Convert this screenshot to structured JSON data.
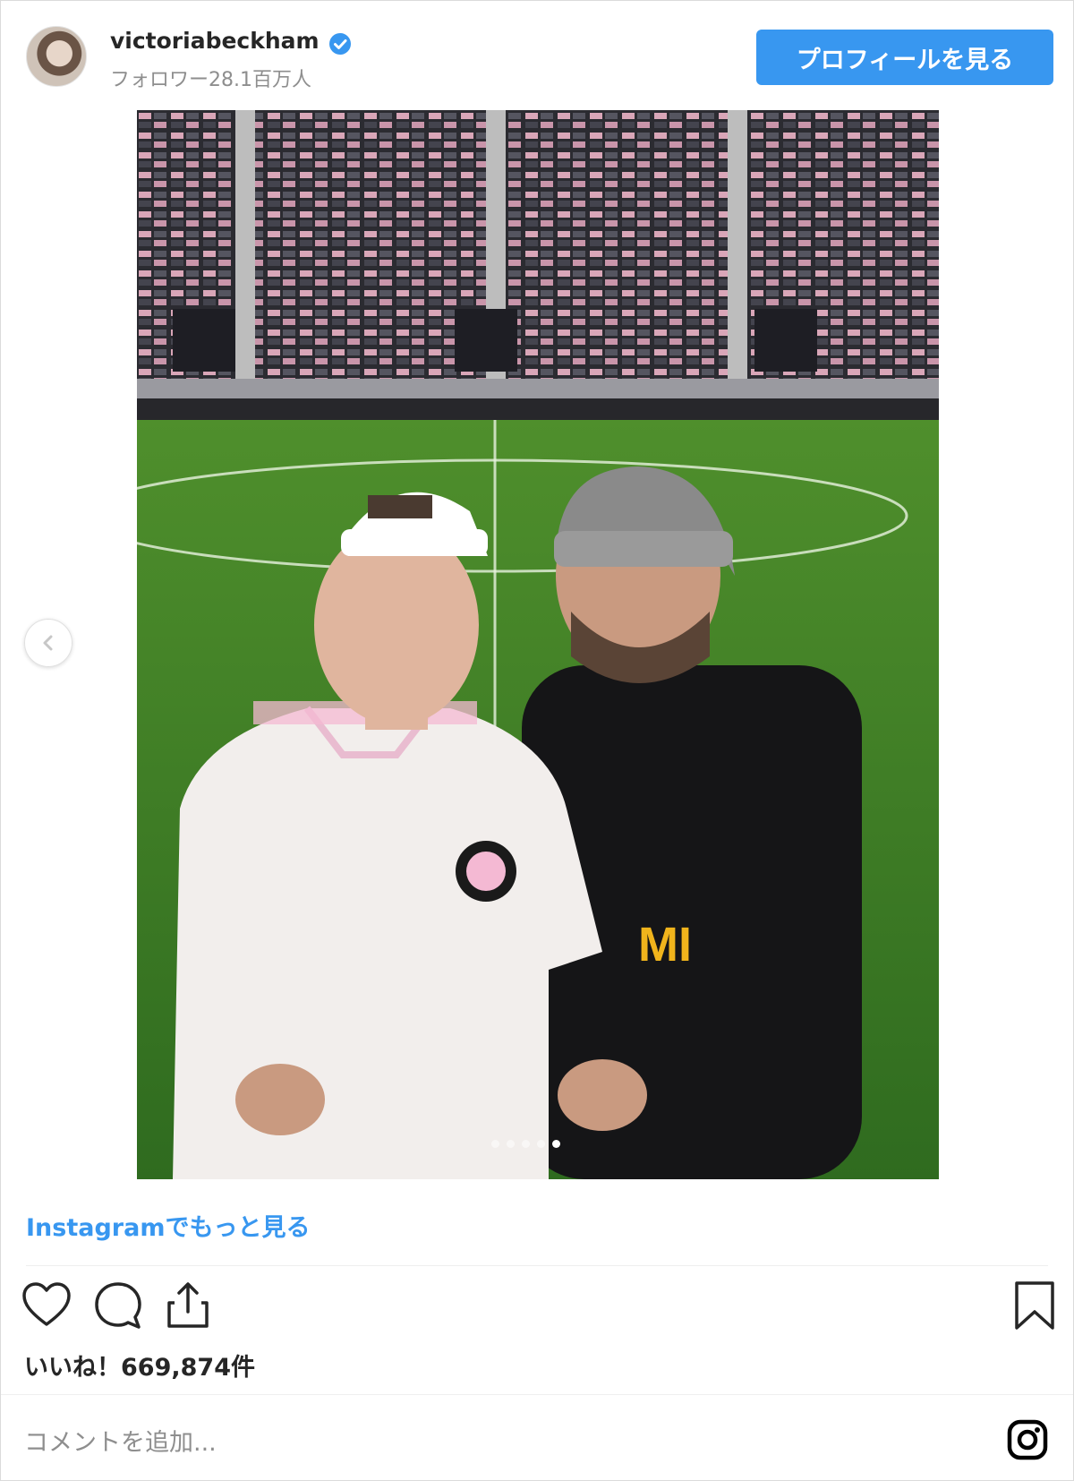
{
  "header": {
    "username": "victoriabeckham",
    "followers": "フォロワー28.1百万人",
    "profile_button": "プロフィールを見る"
  },
  "post": {
    "image_alt": "Instagram photo",
    "carousel": {
      "slide_count": 5,
      "active_slide": 5
    }
  },
  "more_link": "Instagramでもっと見る",
  "actions": {
    "icons": [
      "heart-icon",
      "comment-icon",
      "share-icon",
      "bookmark-icon"
    ]
  },
  "likes": "いいね！669,874件",
  "comment_placeholder": "コメントを追加...",
  "colors": {
    "accent": "#3897f0",
    "text": "#262626",
    "muted": "#8e8e8e"
  }
}
